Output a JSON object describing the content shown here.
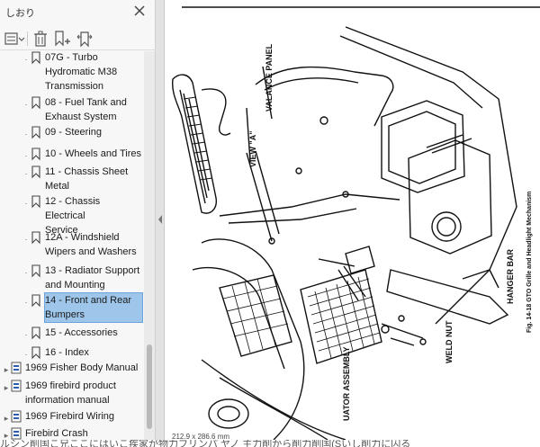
{
  "panel": {
    "title": "しおり",
    "close_icon": "close-icon",
    "toolbar": {
      "options_icon": "options-menu-icon",
      "delete_icon": "trash-icon",
      "new_icon": "new-bookmark-icon",
      "expand_icon": "expand-bookmark-icon"
    }
  },
  "bookmarks": [
    {
      "label": "07G - Turbo\nHydromatic M38\nTransmission",
      "level": 1
    },
    {
      "label": "08 - Fuel Tank and\nExhaust System",
      "level": 1
    },
    {
      "label": "09 - Steering",
      "level": 1
    },
    {
      "label": "10 - Wheels and Tires",
      "level": 1
    },
    {
      "label": "11 - Chassis Sheet\nMetal",
      "level": 1
    },
    {
      "label": "12 - Chassis Electrical\nService",
      "level": 1
    },
    {
      "label": "12A - Windshield\nWipers and Washers",
      "level": 1
    },
    {
      "label": "13 - Radiator Support\nand Mounting",
      "level": 1
    },
    {
      "label": "14 - Front and Rear\nBumpers",
      "level": 1,
      "selected": true
    },
    {
      "label": "15 - Accessories",
      "level": 1
    },
    {
      "label": "16 - Index",
      "level": 1
    },
    {
      "label": "1969 Fisher Body Manual",
      "level": 0
    },
    {
      "label": "1969 firebird product\ninformation manual",
      "level": 0
    },
    {
      "label": "1969 Firebird Wiring",
      "level": 0
    },
    {
      "label": "Firebird Crash",
      "level": 0
    }
  ],
  "document": {
    "page_size": "212.9 x 286.6 mm",
    "labels": {
      "valance_panel": "VALANCE PANEL",
      "view_a": "VIEW \"A\"",
      "hanger_bar": "HANGER BAR",
      "weld_nut": "WELD NUT",
      "actuator": "UATOR ASSEMBLY",
      "caption": "Fig. 14-18 GTO Grille and Headlight Mechanism"
    }
  },
  "bottom_text": "ルシン削国こ兄ここにはいこ疾家が物力フリンパ ヤノ 主力削から削力削国(Sいし削力に囚る",
  "colors": {
    "selection": "#9ec6ea",
    "panel_bg": "#f7f7f7",
    "splitter": "#e2e2e2"
  }
}
